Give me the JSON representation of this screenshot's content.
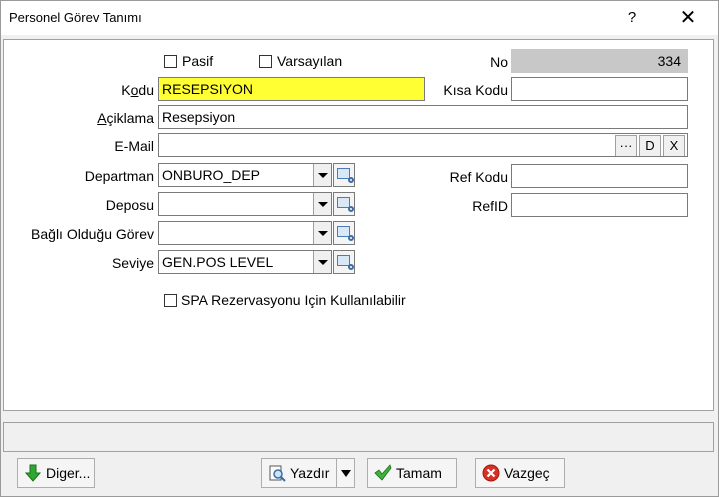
{
  "window": {
    "title": "Personel Görev Tanımı",
    "help": "?",
    "close": "✕"
  },
  "flags": {
    "pasif": "Pasif",
    "varsayilan": "Varsayılan",
    "spa": "SPA Rezervasyonu Için Kullanılabilir"
  },
  "fields": {
    "no": {
      "label": "No",
      "value": "334"
    },
    "kodu": {
      "label_pre": "K",
      "label_ul": "o",
      "label_post": "du",
      "value": "RESEPSIYON"
    },
    "kisa_kodu": {
      "label": "Kısa Kodu",
      "value": ""
    },
    "aciklama": {
      "label_pre": "",
      "label_ul": "A",
      "label_post": "çiklama",
      "value": "Resepsiyon"
    },
    "email": {
      "label": "E-Mail",
      "value": "",
      "btn_more": "···",
      "btn_d": "D",
      "btn_x": "X"
    },
    "departman": {
      "label": "Departman",
      "value": "ONBURO_DEP"
    },
    "deposu": {
      "label": "Deposu",
      "value": ""
    },
    "bagli": {
      "label": "Bağlı Olduğu Görev",
      "value": ""
    },
    "seviye": {
      "label": "Seviye",
      "value": "GEN.POS LEVEL"
    },
    "ref_kodu": {
      "label": "Ref Kodu",
      "value": ""
    },
    "ref_id": {
      "label": "RefID",
      "value": ""
    }
  },
  "status": {
    "text": ""
  },
  "buttons": {
    "diger": "Diger...",
    "yazdir": "Yazdır",
    "tamam": "Tamam",
    "vazgec": "Vazgeç"
  },
  "colors": {
    "highlight": "#ffff33",
    "readonly": "#c8c8c8"
  }
}
